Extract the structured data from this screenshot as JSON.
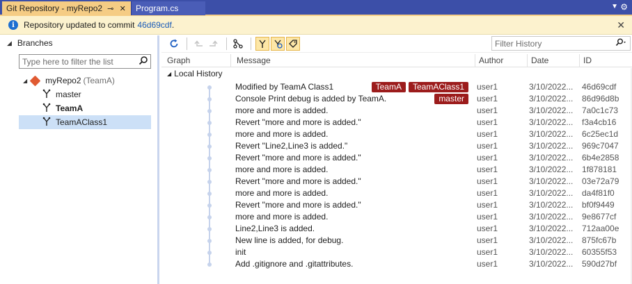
{
  "tabs": [
    {
      "title": "Git Repository - myRepo2",
      "pin": "⊸",
      "close": "✕"
    },
    {
      "title": "Program.cs"
    }
  ],
  "strip": {
    "dropdown": "▼",
    "settings": "⚙"
  },
  "infobar": {
    "text": "Repository updated to commit",
    "commit": "46d69cdf",
    "suffix": ".",
    "close": "✕"
  },
  "branches": {
    "header": "Branches",
    "filter_placeholder": "Type here to filter the list",
    "repo": {
      "name": "myRepo2",
      "suffix": "(TeamA)"
    },
    "items": [
      {
        "name": "master",
        "bold": false,
        "selected": false
      },
      {
        "name": "TeamA",
        "bold": true,
        "selected": false
      },
      {
        "name": "TeamAClass1",
        "bold": false,
        "selected": true
      }
    ]
  },
  "history": {
    "filter_placeholder": "Filter History",
    "columns": {
      "graph": "Graph",
      "message": "Message",
      "author": "Author",
      "date": "Date",
      "id": "ID"
    },
    "group": "Local History",
    "commits": [
      {
        "message": "Modified by TeamA Class1",
        "tags": [
          "TeamA",
          "TeamAClass1"
        ],
        "author": "user1",
        "date": "3/10/2022...",
        "id": "46d69cdf"
      },
      {
        "message": "Console Print debug is added by TeamA.",
        "tags": [
          "master"
        ],
        "author": "user1",
        "date": "3/10/2022...",
        "id": "86d96d8b"
      },
      {
        "message": "more and more is added.",
        "tags": [],
        "author": "user1",
        "date": "3/10/2022...",
        "id": "7a0c1c73"
      },
      {
        "message": "Revert \"more and more is added.\"",
        "tags": [],
        "author": "user1",
        "date": "3/10/2022...",
        "id": "f3a4cb16"
      },
      {
        "message": "more and more is added.",
        "tags": [],
        "author": "user1",
        "date": "3/10/2022...",
        "id": "6c25ec1d"
      },
      {
        "message": "Revert \"Line2,Line3 is added.\"",
        "tags": [],
        "author": "user1",
        "date": "3/10/2022...",
        "id": "969c7047"
      },
      {
        "message": "Revert \"more and more is added.\"",
        "tags": [],
        "author": "user1",
        "date": "3/10/2022...",
        "id": "6b4e2858"
      },
      {
        "message": "more and more is added.",
        "tags": [],
        "author": "user1",
        "date": "3/10/2022...",
        "id": "1f878181"
      },
      {
        "message": "Revert \"more and more is added.\"",
        "tags": [],
        "author": "user1",
        "date": "3/10/2022...",
        "id": "03e72a79"
      },
      {
        "message": "more and more is added.",
        "tags": [],
        "author": "user1",
        "date": "3/10/2022...",
        "id": "da4f81f0"
      },
      {
        "message": "Revert \"more and more is added.\"",
        "tags": [],
        "author": "user1",
        "date": "3/10/2022...",
        "id": "bf0f9449"
      },
      {
        "message": "more and more is added.",
        "tags": [],
        "author": "user1",
        "date": "3/10/2022...",
        "id": "9e8677cf"
      },
      {
        "message": "Line2,Line3 is added.",
        "tags": [],
        "author": "user1",
        "date": "3/10/2022...",
        "id": "712aa00e"
      },
      {
        "message": "New line is added, for debug.",
        "tags": [],
        "author": "user1",
        "date": "3/10/2022...",
        "id": "875fc67b"
      },
      {
        "message": "init",
        "tags": [],
        "author": "user1",
        "date": "3/10/2022...",
        "id": "60355f53"
      },
      {
        "message": "Add .gitignore and .gitattributes.",
        "tags": [],
        "author": "user1",
        "date": "3/10/2022...",
        "id": "590d27bf"
      }
    ]
  },
  "colors": {
    "tabstrip": "#3c4fa8",
    "active_tab": "#f5cc84",
    "infobar": "#fcf2ce",
    "tag": "#9c1c1c",
    "selection": "#cce0f7"
  }
}
